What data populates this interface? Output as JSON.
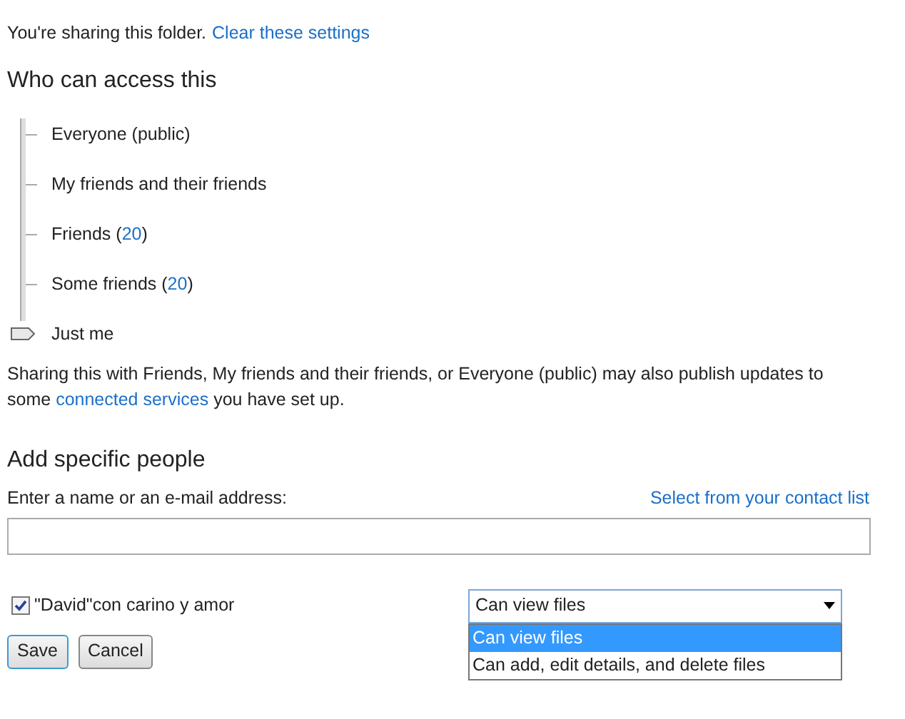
{
  "sharing_notice": {
    "text": "You're sharing this folder.",
    "link": "Clear these settings"
  },
  "access": {
    "heading": "Who can access this",
    "options": [
      {
        "label": "Everyone (public)",
        "selected": false
      },
      {
        "label": "My friends and their friends",
        "selected": false
      },
      {
        "label": "Friends (",
        "count": "20",
        "suffix": ")",
        "selected": false
      },
      {
        "label": "Some friends (",
        "count": "20",
        "suffix": ")",
        "selected": false
      },
      {
        "label": "Just me",
        "selected": true
      }
    ],
    "note": {
      "before": "Sharing this with Friends, My friends and their friends, or Everyone (public) may also publish updates to some",
      "link": "connected services",
      "after": "you have set up."
    }
  },
  "add_people": {
    "heading": "Add specific people",
    "field_label": "Enter a name or an e-mail address:",
    "contact_link": "Select from your contact list",
    "people": [
      {
        "name": "\"David\"con carino y amor",
        "checked": true,
        "permission": "Can view files",
        "dropdown_open": true,
        "options": [
          {
            "label": "Can view files",
            "selected": true
          },
          {
            "label": "Can add, edit details, and delete files",
            "selected": false
          }
        ]
      }
    ]
  },
  "buttons": [
    {
      "label": "Save",
      "focused": true
    },
    {
      "label": "Cancel",
      "focused": false
    }
  ]
}
